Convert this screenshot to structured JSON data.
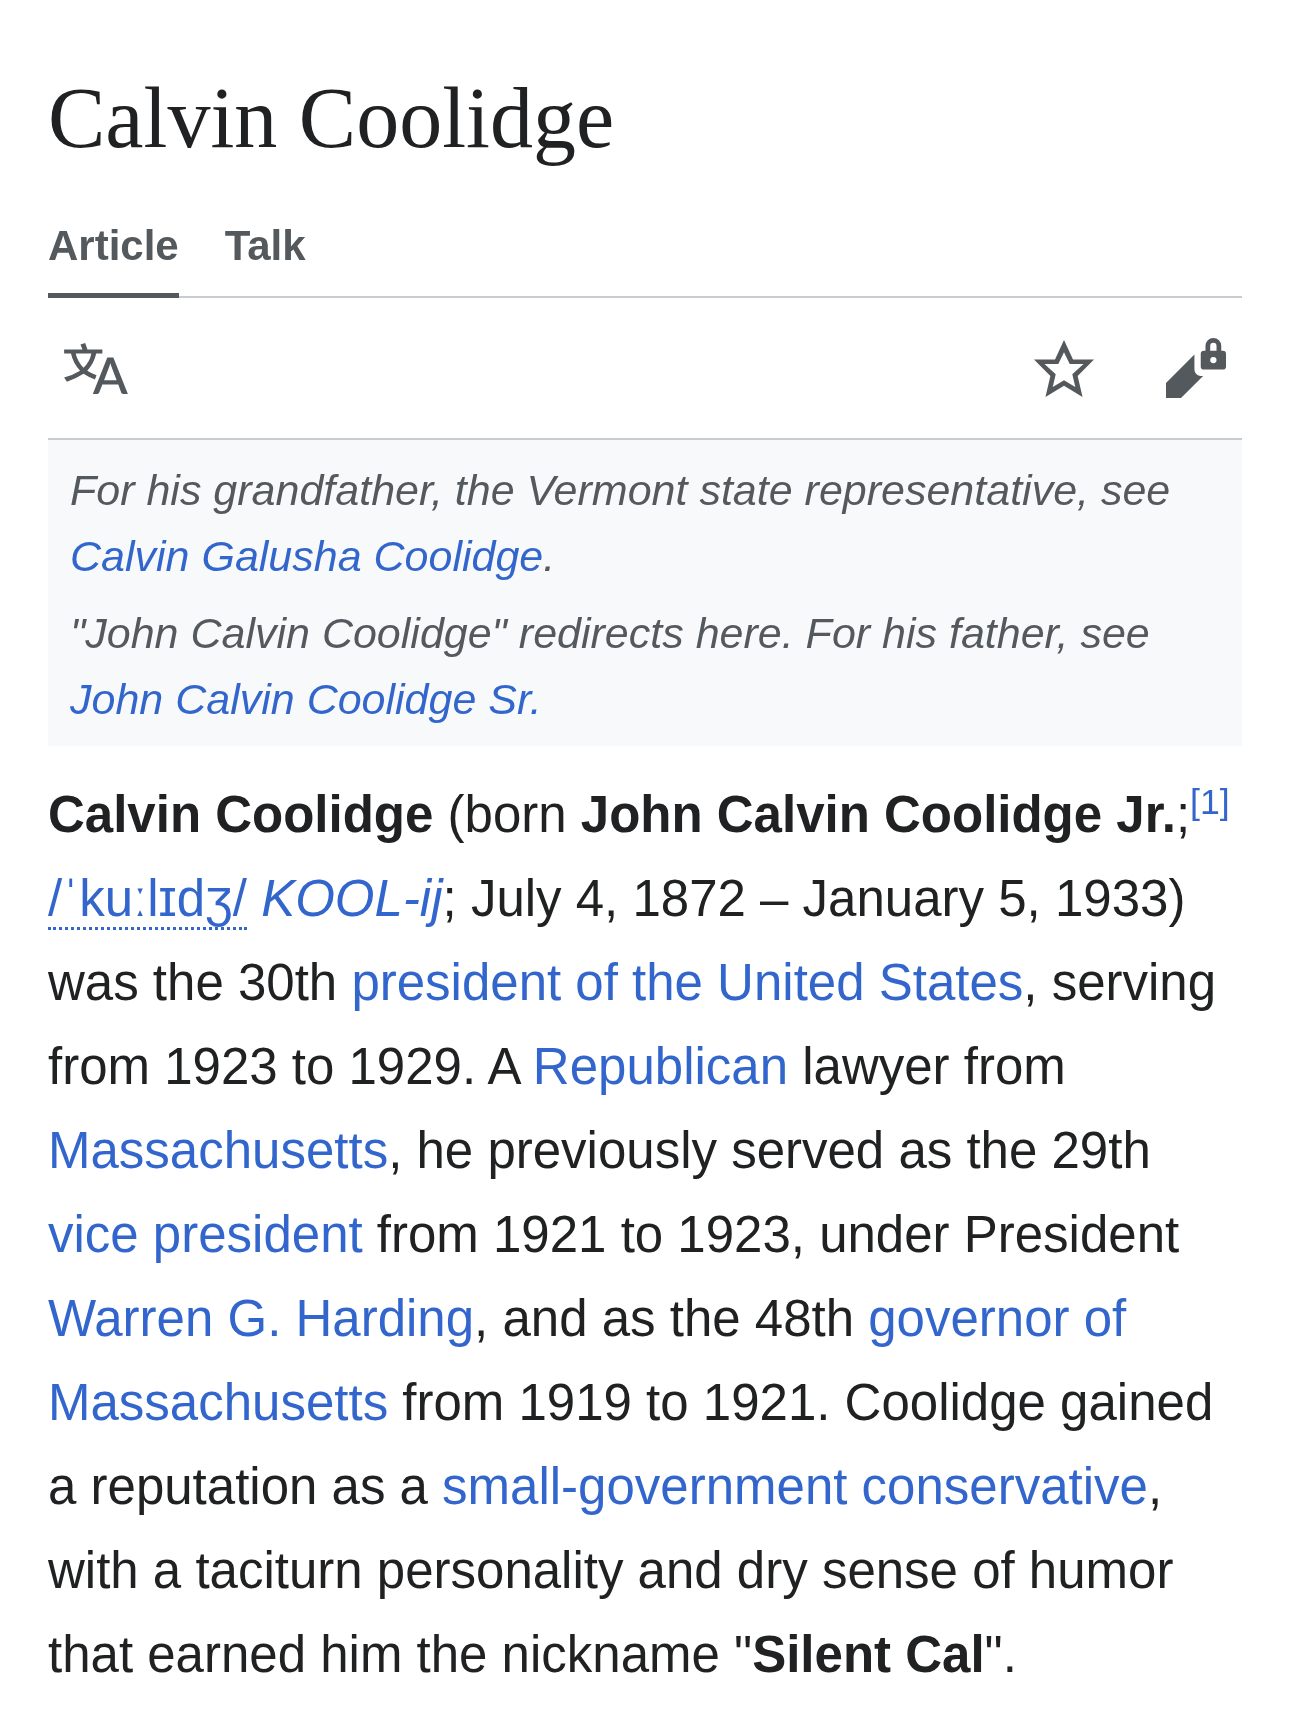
{
  "page": {
    "title": "Calvin Coolidge"
  },
  "tabs": [
    {
      "label": "Article",
      "selected": true
    },
    {
      "label": "Talk",
      "selected": false
    }
  ],
  "page_actions": {
    "watched": false,
    "edit_protected": true
  },
  "hatnotes": [
    [
      {
        "kind": "text",
        "text": "For his grandfather, the Vermont state representative, see "
      },
      {
        "kind": "link",
        "text": "Calvin Galusha Coolidge"
      },
      {
        "kind": "text",
        "text": "."
      }
    ],
    [
      {
        "kind": "text",
        "text": "\"John Calvin Coolidge\" redirects here. For his father, see "
      },
      {
        "kind": "link",
        "text": "John Calvin Coolidge Sr."
      }
    ]
  ],
  "paragraph": [
    {
      "kind": "text",
      "text": "**Calvin Coolidge** (born **John Calvin Coolidge Jr.**;"
    },
    {
      "kind": "ref",
      "text": "[1]"
    },
    {
      "kind": "ipa",
      "text": "/ˈkuːlɪdʒ/"
    },
    {
      "kind": "respell",
      "text": "KOOL-ij"
    },
    {
      "kind": "text",
      "text": "; July 4, 1872 – January 5, 1933) was the 30th "
    },
    {
      "kind": "link",
      "text": "president of the United States"
    },
    {
      "kind": "text",
      "text": ", serving from 1923 to 1929. A "
    },
    {
      "kind": "link",
      "text": "Republican"
    },
    {
      "kind": "text",
      "text": " lawyer from "
    },
    {
      "kind": "link",
      "text": "Massachusetts"
    },
    {
      "kind": "text",
      "text": ", he previously served as the 29th "
    },
    {
      "kind": "link",
      "text": "vice president"
    },
    {
      "kind": "text",
      "text": " from 1921 to 1923, under President "
    },
    {
      "kind": "link",
      "text": "Warren G. Harding"
    },
    {
      "kind": "text",
      "text": ", and as the 48th "
    },
    {
      "kind": "link",
      "text": "governor of"
    },
    {
      "kind": "link",
      "text": "Massachusetts"
    },
    {
      "kind": "text",
      "text": " from 1919 to 1921. Coolidge gained a reputation as a "
    },
    {
      "kind": "link",
      "text": "small-government conservative"
    },
    {
      "kind": "text",
      "text": ", with a taciturn personality and dry sense of humor that earned him the nickname \"**Silent Cal**\"."
    }
  ]
}
